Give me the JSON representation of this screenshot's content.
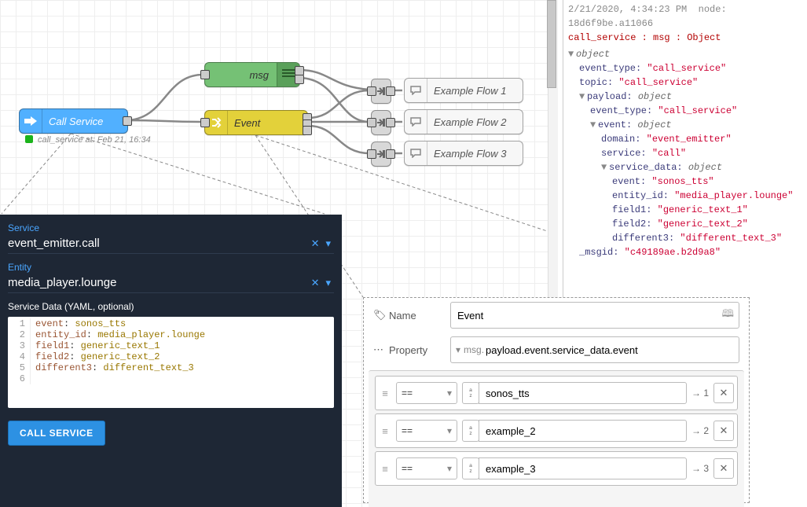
{
  "canvas": {
    "call_label": "Call Service",
    "msg_label": "msg",
    "event_label": "Event",
    "status_text": "call_service at: Feb 21, 16:34",
    "flows": [
      "Example Flow 1",
      "Example Flow 2",
      "Example Flow 3"
    ]
  },
  "debug": {
    "ts": "2/21/2020, 4:34:23 PM",
    "node_id": "node: 18d6f9be.a11066",
    "path": "call_service : msg : Object",
    "tree": {
      "root": "object",
      "event_type_k": "event_type:",
      "event_type_v": "\"call_service\"",
      "topic_k": "topic:",
      "topic_v": "\"call_service\"",
      "payload": "payload:",
      "obj": "object",
      "p_event_type_v": "\"call_service\"",
      "event": "event:",
      "domain_k": "domain:",
      "domain_v": "\"event_emitter\"",
      "service_k": "service:",
      "service_v": "\"call\"",
      "service_data": "service_data:",
      "sd_event_k": "event:",
      "sd_event_v": "\"sonos_tts\"",
      "entity_id_k": "entity_id:",
      "entity_id_v": "\"media_player.lounge\"",
      "f1k": "field1:",
      "f1v": "\"generic_text_1\"",
      "f2k": "field2:",
      "f2v": "\"generic_text_2\"",
      "d3k": "different3:",
      "d3v": "\"different_text_3\"",
      "msgid_k": "_msgid:",
      "msgid_v": "\"c49189ae.b2d9a8\""
    }
  },
  "service_panel": {
    "service_label": "Service",
    "service_value": "event_emitter.call",
    "entity_label": "Entity",
    "entity_value": "media_player.lounge",
    "yaml_label": "Service Data (YAML, optional)",
    "yaml": [
      {
        "k": "event",
        "v": "sonos_tts"
      },
      {
        "k": "entity_id",
        "v": "media_player.lounge"
      },
      {
        "k": "field1",
        "v": "generic_text_1"
      },
      {
        "k": "field2",
        "v": "generic_text_2"
      },
      {
        "k": "different3",
        "v": "different_text_3"
      }
    ],
    "button": "CALL SERVICE"
  },
  "switch_editor": {
    "name_label": "Name",
    "name_value": "Event",
    "prop_label": "Property",
    "prop_prefix": "msg.",
    "prop_value": "payload.event.service_data.event",
    "op": "==",
    "rules": [
      {
        "v": "sonos_tts",
        "out": "→ 1"
      },
      {
        "v": "example_2",
        "out": "→ 2"
      },
      {
        "v": "example_3",
        "out": "→ 3"
      }
    ]
  }
}
